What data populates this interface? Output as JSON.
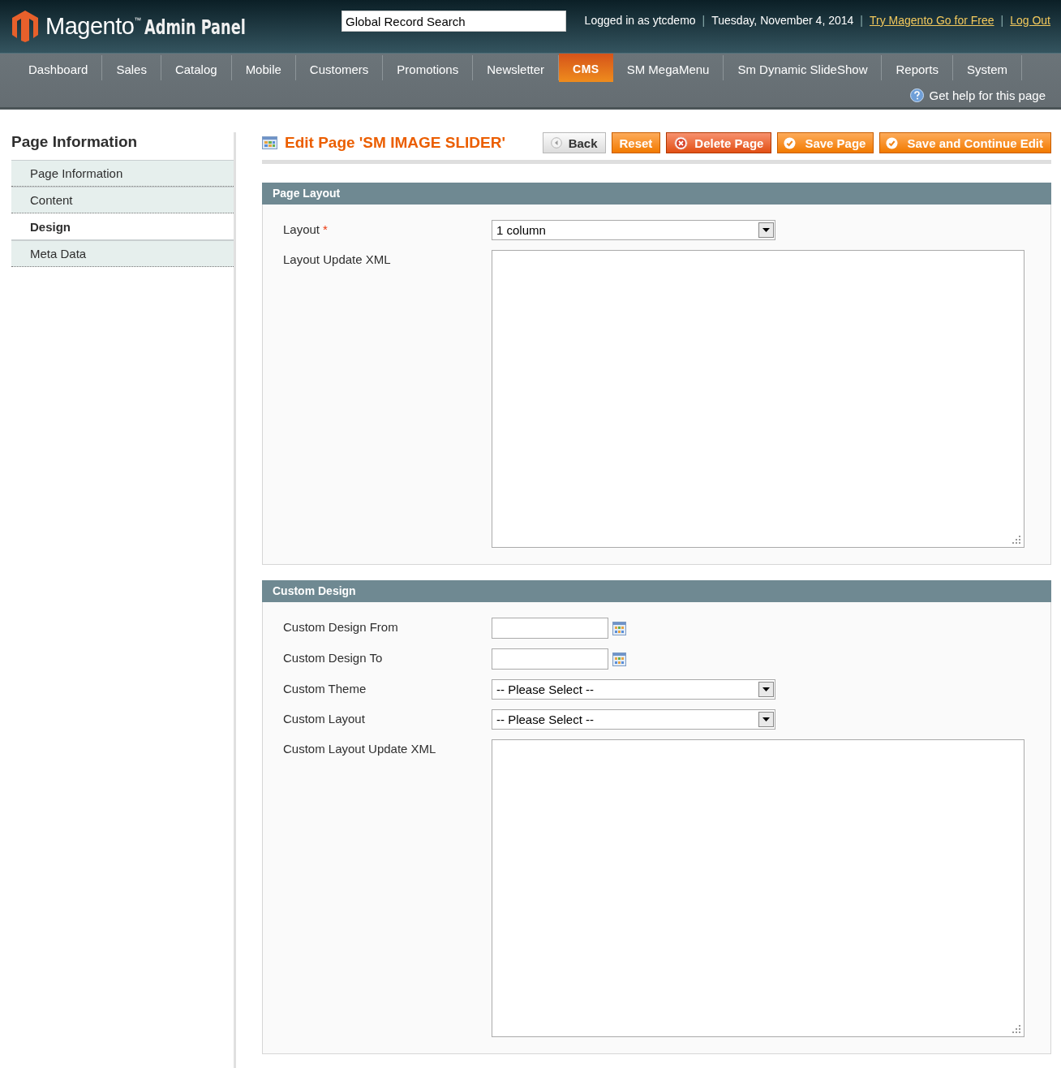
{
  "header": {
    "logo": "Magento$^{™}$",
    "logo_sub": "Admin Panel",
    "search": {
      "value": "Global Record Search"
    },
    "separator": "|",
    "user_bar": [
      {
        "kind": "text",
        "text": "Logged in as ytcdemo"
      },
      {
        "kind": "text",
        "text": "Tuesday, November 4, 2014"
      },
      {
        "kind": "link",
        "text": "Try Magento Go for Free"
      },
      {
        "kind": "link",
        "text": "Log Out"
      }
    ]
  },
  "nav": {
    "items": [
      {
        "label": "Dashboard",
        "selected": false
      },
      {
        "label": "Sales",
        "selected": false
      },
      {
        "label": "Catalog",
        "selected": false
      },
      {
        "label": "Mobile",
        "selected": false
      },
      {
        "label": "Customers",
        "selected": false
      },
      {
        "label": "Promotions",
        "selected": false
      },
      {
        "label": "Newsletter",
        "selected": false
      },
      {
        "label": "CMS",
        "selected": true
      },
      {
        "label": "SM MegaMenu",
        "selected": false
      },
      {
        "label": "Sm Dynamic SlideShow",
        "selected": false
      },
      {
        "label": "Reports",
        "selected": false
      },
      {
        "label": "System",
        "selected": false
      }
    ],
    "help": "Get help for this page"
  },
  "sidebar": {
    "title": "Page Information",
    "tabs": [
      {
        "label": "Page Information",
        "selected": false
      },
      {
        "label": "Content",
        "selected": false
      },
      {
        "label": "Design",
        "selected": true
      },
      {
        "label": "Meta Data",
        "selected": false
      }
    ]
  },
  "page": {
    "title": "Edit Page 'SM IMAGE SLIDER'",
    "buttons": [
      {
        "kind": "back",
        "label": "Back"
      },
      {
        "kind": "plain",
        "label": "Reset"
      },
      {
        "kind": "delete",
        "label": "Delete Page"
      },
      {
        "kind": "save",
        "label": "Save Page"
      },
      {
        "kind": "save",
        "label": "Save and Continue Edit"
      }
    ],
    "sections": [
      {
        "title": "Page Layout",
        "fields": [
          {
            "label": "Layout",
            "required_mark": "*",
            "kind": "select",
            "value": "1 column"
          },
          {
            "label": "Layout Update XML",
            "kind": "textarea"
          }
        ]
      },
      {
        "title": "Custom Design",
        "fields": [
          {
            "label": "Custom Design From",
            "kind": "date"
          },
          {
            "label": "Custom Design To",
            "kind": "date"
          },
          {
            "label": "Custom Theme",
            "kind": "select",
            "value": "-- Please Select --"
          },
          {
            "label": "Custom Layout",
            "kind": "select",
            "value": "-- Please Select --"
          },
          {
            "label": "Custom Layout Update XML",
            "kind": "textarea"
          }
        ]
      }
    ]
  }
}
